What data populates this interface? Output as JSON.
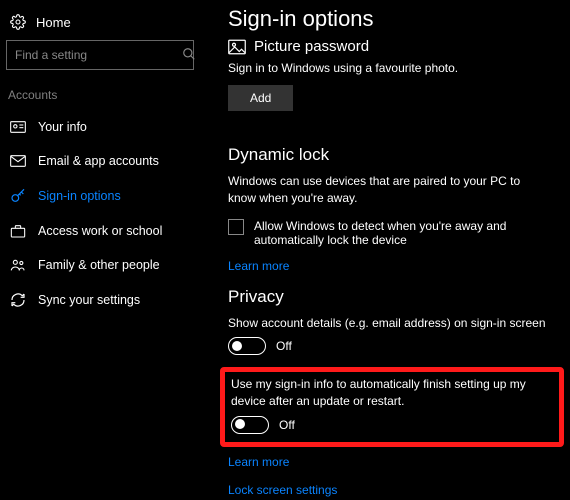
{
  "sidebar": {
    "home": "Home",
    "search_placeholder": "Find a setting",
    "section": "Accounts",
    "items": [
      {
        "label": "Your info"
      },
      {
        "label": "Email & app accounts"
      },
      {
        "label": "Sign-in options"
      },
      {
        "label": "Access work or school"
      },
      {
        "label": "Family & other people"
      },
      {
        "label": "Sync your settings"
      }
    ]
  },
  "main": {
    "title": "Sign-in options",
    "picture_password": {
      "heading": "Picture password",
      "desc": "Sign in to Windows using a favourite photo.",
      "add": "Add"
    },
    "dynamic_lock": {
      "heading": "Dynamic lock",
      "desc": "Windows can use devices that are paired to your PC to know when you're away.",
      "checkbox": "Allow Windows to detect when you're away and automatically lock the device",
      "learn_more": "Learn more"
    },
    "privacy": {
      "heading": "Privacy",
      "toggle1_label": "Show account details (e.g. email address) on sign-in screen",
      "toggle1_state": "Off",
      "toggle2_label": "Use my sign-in info to automatically finish setting up my device after an update or restart.",
      "toggle2_state": "Off",
      "learn_more": "Learn more",
      "lock_screen": "Lock screen settings"
    }
  }
}
